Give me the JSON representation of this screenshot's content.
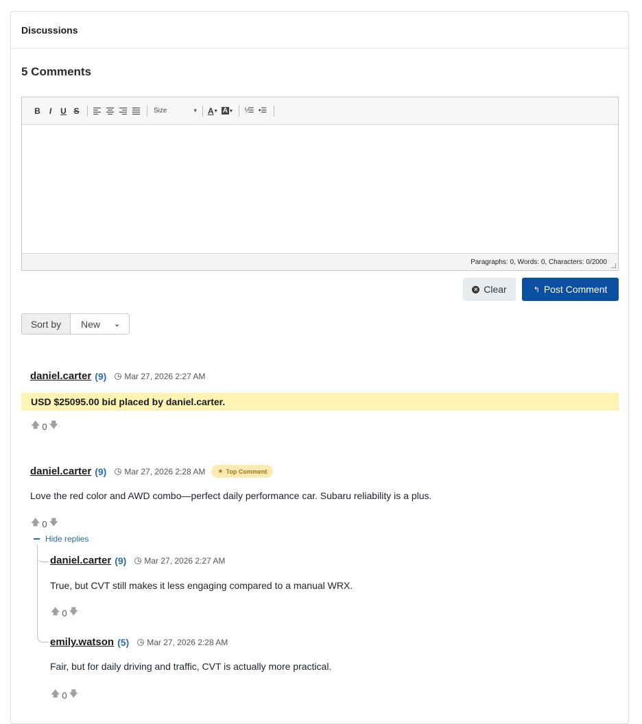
{
  "panel": {
    "title": "Discussions"
  },
  "comments_count_label": "5 Comments",
  "toolbar": {
    "bold": "B",
    "italic": "I",
    "underline": "U",
    "strike": "S",
    "size_label": "Size",
    "font_color_label": "A",
    "bg_color_label": "A",
    "icons": [
      "bold-icon",
      "italic-icon",
      "underline-icon",
      "strikethrough-icon",
      "align-left-icon",
      "align-center-icon",
      "align-right-icon",
      "align-justify-icon",
      "font-color-icon",
      "background-color-icon",
      "ordered-list-icon",
      "unordered-list-icon"
    ]
  },
  "editor": {
    "value": "",
    "status": "Paragraphs: 0, Words: 0, Characters: 0/2000"
  },
  "buttons": {
    "clear": "Clear",
    "post": "Post Comment"
  },
  "sort": {
    "label": "Sort by",
    "selected": "New"
  },
  "colors": {
    "primary": "#0b4fa3",
    "link": "#2a6db5",
    "highlight": "#fdf4b4",
    "badge_bg": "#fde9b4"
  },
  "comments": [
    {
      "user": "daniel.carter",
      "rep": "(9)",
      "time": "Mar 27, 2026 2:27 AM",
      "text": "USD $25095.00 bid placed by daniel.carter.",
      "votes": "0"
    },
    {
      "user": "daniel.carter",
      "rep": "(9)",
      "time": "Mar 27, 2026 2:28 AM",
      "badge": "Top Comment",
      "text": "Love the red color and AWD combo—perfect daily performance car. Subaru reliability is a plus.",
      "votes": "0",
      "hide_replies": "Hide replies",
      "replies": [
        {
          "user": "daniel.carter",
          "rep": "(9)",
          "time": "Mar 27, 2026 2:27 AM",
          "text": "True, but CVT still makes it less engaging compared to a manual WRX.",
          "votes": "0"
        },
        {
          "user": "emily.watson",
          "rep": "(5)",
          "time": "Mar 27, 2026 2:28 AM",
          "text": "Fair, but for daily driving and traffic, CVT is actually more practical.",
          "votes": "0"
        }
      ]
    }
  ]
}
